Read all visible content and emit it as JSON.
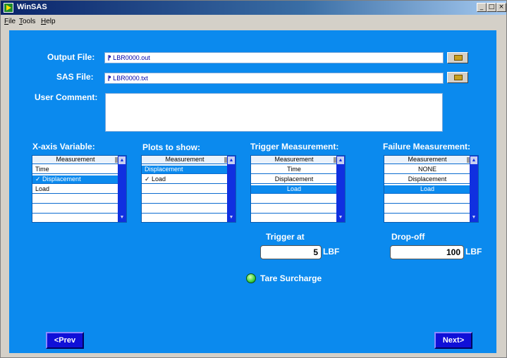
{
  "window": {
    "title": "WinSAS",
    "controls": [
      "_",
      "□",
      "×"
    ]
  },
  "menu": [
    "File",
    "Tools",
    "Help"
  ],
  "output_file": {
    "label": "Output File:",
    "value": "LBR0000.out"
  },
  "sas_file": {
    "label": "SAS File:",
    "value": "LBR0000.txt"
  },
  "user_comment": {
    "label": "User Comment:",
    "value": ""
  },
  "lists": [
    {
      "title": "X-axis Variable:",
      "rows": [
        "Measurement",
        "Time",
        "✓ Displacement",
        "Load",
        "",
        ""
      ],
      "selected": 2
    },
    {
      "title": "Plots to show:",
      "rows": [
        "Measurement",
        "Displacement",
        "✓ Load",
        "",
        "",
        ""
      ],
      "selected": 1
    },
    {
      "title": "Trigger Measurement:",
      "rows": [
        "Measurement",
        "Time",
        "Displacement",
        "Load",
        "",
        ""
      ],
      "selected": 3
    },
    {
      "title": "Failure Measurement:",
      "rows": [
        "Measurement",
        "NONE",
        "Displacement",
        "Load",
        "",
        ""
      ],
      "selected": 3
    }
  ],
  "trigger": {
    "label": "Trigger at",
    "value": "5",
    "unit": "LBF"
  },
  "dropoff": {
    "label": "Drop-off",
    "value": "100",
    "unit": "LBF"
  },
  "tare": {
    "label": "Tare Surcharge",
    "color": "#3ad040"
  },
  "nav": {
    "prev": "<Prev",
    "next": "Next>"
  }
}
